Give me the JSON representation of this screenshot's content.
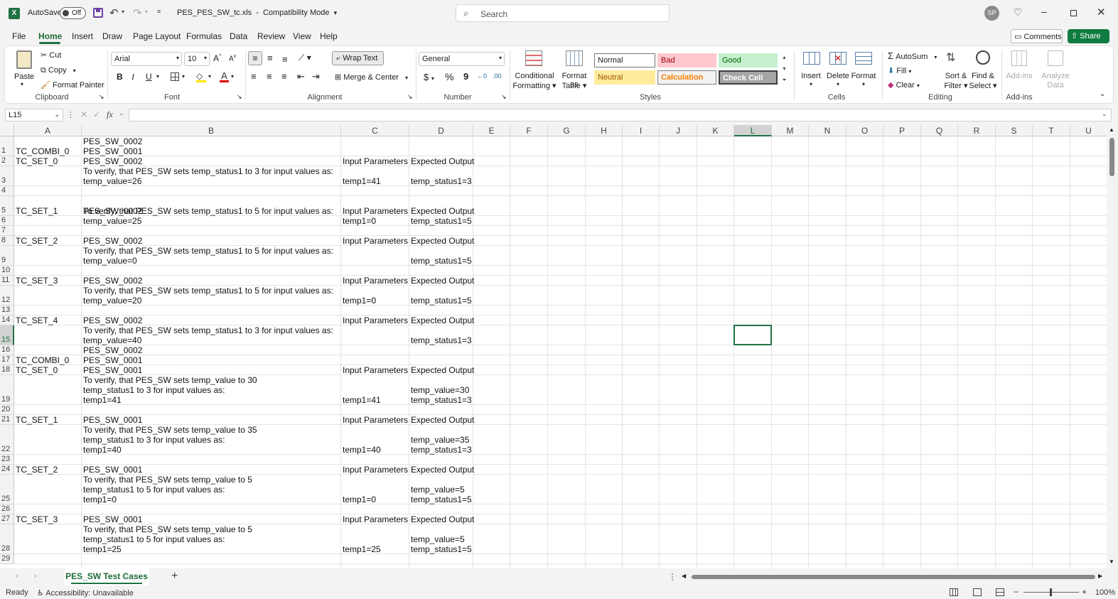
{
  "title": {
    "autosave": "AutoSave",
    "toggle": "Off",
    "filename": "PES_PES_SW_tc.xls",
    "sep": "-",
    "mode": "Compatibility Mode",
    "search_placeholder": "Search",
    "avatar": "SP"
  },
  "menu": [
    "File",
    "Home",
    "Insert",
    "Draw",
    "Page Layout",
    "Formulas",
    "Data",
    "Review",
    "View",
    "Help"
  ],
  "buttons": {
    "comments": "Comments",
    "share": "Share"
  },
  "ribbon": {
    "clipboard": {
      "paste": "Paste",
      "cut": "Cut",
      "copy": "Copy",
      "format_painter": "Format Painter",
      "label": "Clipboard"
    },
    "font": {
      "name": "Arial",
      "size": "10",
      "label": "Font",
      "bold": "B",
      "italic": "I",
      "underline": "U"
    },
    "alignment": {
      "wrap": "Wrap Text",
      "merge": "Merge & Center",
      "label": "Alignment"
    },
    "number": {
      "format": "General",
      "label": "Number",
      "currency": "$",
      "percent": "%",
      "comma": "9"
    },
    "styles": {
      "cond1": "Conditional",
      "cond2": "Formatting",
      "fat1": "Format as",
      "fat2": "Table",
      "normal": "Normal",
      "bad": "Bad",
      "good": "Good",
      "neutral": "Neutral",
      "calculation": "Calculation",
      "check": "Check Cell",
      "label": "Styles"
    },
    "cells": {
      "insert": "Insert",
      "delete": "Delete",
      "format": "Format",
      "label": "Cells"
    },
    "editing": {
      "autosum": "AutoSum",
      "fill": "Fill",
      "clear": "Clear",
      "sort1": "Sort &",
      "sort2": "Filter",
      "find1": "Find &",
      "find2": "Select",
      "label": "Editing"
    },
    "addins": {
      "addins": "Add-ins",
      "analyze1": "Analyze",
      "analyze2": "Data",
      "label": "Add-ins"
    }
  },
  "namebox": "L15",
  "fx": "fx",
  "columns": [
    "A",
    "B",
    "C",
    "D",
    "E",
    "F",
    "G",
    "H",
    "I",
    "J",
    "K",
    "L",
    "M",
    "N",
    "O",
    "P",
    "Q",
    "R",
    "S",
    "T",
    "U"
  ],
  "rows": [
    "1",
    "2",
    "3",
    "4",
    "5",
    "6",
    "7",
    "8",
    "9",
    "10",
    "11",
    "12",
    "13",
    "14",
    "15",
    "16",
    "17",
    "18",
    "19",
    "20",
    "21",
    "22",
    "23",
    "24",
    "25",
    "26",
    "27",
    "28",
    "29"
  ],
  "cells": [
    {
      "col": "A",
      "row": 1,
      "lines": [
        "TC_COMBI_0"
      ]
    },
    {
      "col": "B",
      "row": 1,
      "lines": [
        "PES_SW_0002",
        "PES_SW_0001"
      ]
    },
    {
      "col": "A",
      "row": 2,
      "lines": [
        "TC_SET_0"
      ]
    },
    {
      "col": "B",
      "row": 2,
      "lines": [
        "PES_SW_0002"
      ]
    },
    {
      "col": "C",
      "row": 2,
      "lines": [
        "Input Parameters"
      ]
    },
    {
      "col": "D",
      "row": 2,
      "lines": [
        "Expected Output"
      ]
    },
    {
      "col": "B",
      "row": 3,
      "lines": [
        "To verify, that PES_SW sets temp_status1 to 3 for input values as:",
        "temp_value=26"
      ]
    },
    {
      "col": "C",
      "row": 3,
      "lines": [
        "temp1=41"
      ]
    },
    {
      "col": "D",
      "row": 3,
      "lines": [
        "temp_status1=3"
      ]
    },
    {
      "col": "A",
      "row": 5,
      "lines": [
        "TC_SET_1"
      ]
    },
    {
      "col": "B",
      "row": 5,
      "lines": [
        "PES_SW_0002"
      ]
    },
    {
      "col": "C",
      "row": 5,
      "lines": [
        "Input Parameters"
      ]
    },
    {
      "col": "D",
      "row": 5,
      "lines": [
        "Expected Output"
      ]
    },
    {
      "col": "B",
      "row": 6,
      "lines": [
        "To verify, that PES_SW sets temp_status1 to 5 for input values as:",
        "temp_value=25"
      ]
    },
    {
      "col": "C",
      "row": 6,
      "lines": [
        "temp1=0"
      ]
    },
    {
      "col": "D",
      "row": 6,
      "lines": [
        "temp_status1=5"
      ]
    },
    {
      "col": "A",
      "row": 8,
      "lines": [
        "TC_SET_2"
      ]
    },
    {
      "col": "B",
      "row": 8,
      "lines": [
        "PES_SW_0002"
      ]
    },
    {
      "col": "C",
      "row": 8,
      "lines": [
        "Input Parameters"
      ]
    },
    {
      "col": "D",
      "row": 8,
      "lines": [
        "Expected Output"
      ]
    },
    {
      "col": "B",
      "row": 9,
      "lines": [
        "To verify, that PES_SW sets temp_status1 to 5 for input values as:",
        "temp_value=0"
      ]
    },
    {
      "col": "D",
      "row": 9,
      "lines": [
        "temp_status1=5"
      ]
    },
    {
      "col": "A",
      "row": 11,
      "lines": [
        "TC_SET_3"
      ]
    },
    {
      "col": "B",
      "row": 11,
      "lines": [
        "PES_SW_0002"
      ]
    },
    {
      "col": "C",
      "row": 11,
      "lines": [
        "Input Parameters"
      ]
    },
    {
      "col": "D",
      "row": 11,
      "lines": [
        "Expected Output"
      ]
    },
    {
      "col": "B",
      "row": 12,
      "lines": [
        "To verify, that PES_SW sets temp_status1 to 5 for input values as:",
        "temp_value=20"
      ]
    },
    {
      "col": "C",
      "row": 12,
      "lines": [
        "temp1=0"
      ]
    },
    {
      "col": "D",
      "row": 12,
      "lines": [
        "temp_status1=5"
      ]
    },
    {
      "col": "A",
      "row": 14,
      "lines": [
        "TC_SET_4"
      ]
    },
    {
      "col": "B",
      "row": 14,
      "lines": [
        "PES_SW_0002"
      ]
    },
    {
      "col": "C",
      "row": 14,
      "lines": [
        "Input Parameters"
      ]
    },
    {
      "col": "D",
      "row": 14,
      "lines": [
        "Expected Output"
      ]
    },
    {
      "col": "B",
      "row": 15,
      "lines": [
        "To verify, that PES_SW sets temp_status1 to 3 for input values as:",
        "temp_value=40"
      ]
    },
    {
      "col": "D",
      "row": 15,
      "lines": [
        "temp_status1=3"
      ]
    },
    {
      "col": "A",
      "row": 17,
      "lines": [
        "TC_COMBI_0"
      ]
    },
    {
      "col": "B",
      "row": 17,
      "lines": [
        "PES_SW_0002",
        "PES_SW_0001"
      ]
    },
    {
      "col": "A",
      "row": 18,
      "lines": [
        "TC_SET_0"
      ]
    },
    {
      "col": "B",
      "row": 18,
      "lines": [
        "PES_SW_0001"
      ]
    },
    {
      "col": "C",
      "row": 18,
      "lines": [
        "Input Parameters"
      ]
    },
    {
      "col": "D",
      "row": 18,
      "lines": [
        "Expected Output"
      ]
    },
    {
      "col": "B",
      "row": 19,
      "lines": [
        "To verify, that PES_SW sets temp_value to 30",
        "temp_status1 to 3 for input values as:",
        "temp1=41"
      ]
    },
    {
      "col": "C",
      "row": 19,
      "lines": [
        "temp1=41"
      ]
    },
    {
      "col": "D",
      "row": 19,
      "lines": [
        "temp_value=30",
        "temp_status1=3"
      ]
    },
    {
      "col": "A",
      "row": 21,
      "lines": [
        "TC_SET_1"
      ]
    },
    {
      "col": "B",
      "row": 21,
      "lines": [
        "PES_SW_0001"
      ]
    },
    {
      "col": "C",
      "row": 21,
      "lines": [
        "Input Parameters"
      ]
    },
    {
      "col": "D",
      "row": 21,
      "lines": [
        "Expected Output"
      ]
    },
    {
      "col": "B",
      "row": 22,
      "lines": [
        "To verify, that PES_SW sets temp_value to 35",
        "temp_status1 to 3 for input values as:",
        "temp1=40"
      ]
    },
    {
      "col": "C",
      "row": 22,
      "lines": [
        "temp1=40"
      ]
    },
    {
      "col": "D",
      "row": 22,
      "lines": [
        "temp_value=35",
        "temp_status1=3"
      ]
    },
    {
      "col": "A",
      "row": 24,
      "lines": [
        "TC_SET_2"
      ]
    },
    {
      "col": "B",
      "row": 24,
      "lines": [
        "PES_SW_0001"
      ]
    },
    {
      "col": "C",
      "row": 24,
      "lines": [
        "Input Parameters"
      ]
    },
    {
      "col": "D",
      "row": 24,
      "lines": [
        "Expected Output"
      ]
    },
    {
      "col": "B",
      "row": 25,
      "lines": [
        "To verify, that PES_SW sets temp_value to 5",
        "temp_status1 to 5 for input values as:",
        "temp1=0"
      ]
    },
    {
      "col": "C",
      "row": 25,
      "lines": [
        "temp1=0"
      ]
    },
    {
      "col": "D",
      "row": 25,
      "lines": [
        "temp_value=5",
        "temp_status1=5"
      ]
    },
    {
      "col": "A",
      "row": 27,
      "lines": [
        "TC_SET_3"
      ]
    },
    {
      "col": "B",
      "row": 27,
      "lines": [
        "PES_SW_0001"
      ]
    },
    {
      "col": "C",
      "row": 27,
      "lines": [
        "Input Parameters"
      ]
    },
    {
      "col": "D",
      "row": 27,
      "lines": [
        "Expected Output"
      ]
    },
    {
      "col": "B",
      "row": 28,
      "lines": [
        "To verify, that PES_SW sets temp_value to 5",
        "temp_status1 to 5 for input values as:",
        "temp1=25"
      ]
    },
    {
      "col": "C",
      "row": 28,
      "lines": [
        "temp1=25"
      ]
    },
    {
      "col": "D",
      "row": 28,
      "lines": [
        "temp_value=5",
        "temp_status1=5"
      ]
    }
  ],
  "sheet_tab": "PES_SW Test Cases",
  "status": {
    "ready": "Ready",
    "accessibility": "Accessibility: Unavailable",
    "zoom": "100%"
  },
  "colors": {
    "excel_green": "#1f7244",
    "selection": "#217346",
    "share_bg": "#107c41",
    "bad_bg": "#ffc7ce",
    "bad_fg": "#9c0006",
    "good_bg": "#c6efce",
    "good_fg": "#006100",
    "neutral_bg": "#ffeb9c",
    "neutral_fg": "#9c5700",
    "calc_bg": "#f2f2f2",
    "calc_fg": "#fa7d00",
    "check_bg": "#a5a5a5"
  }
}
